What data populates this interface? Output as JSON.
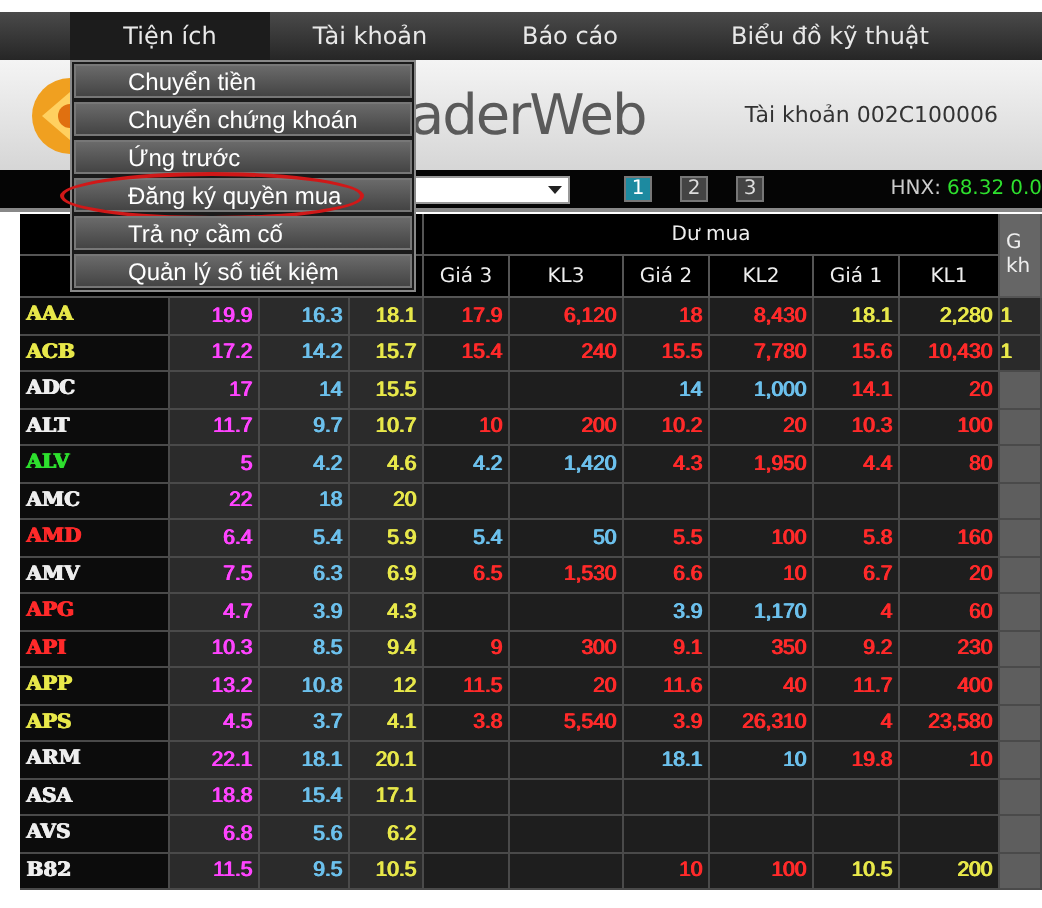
{
  "menu_bar": [
    {
      "label": "Tiện ích",
      "selected": true
    },
    {
      "label": "Tài khoản",
      "selected": false
    },
    {
      "label": "Báo cáo",
      "selected": false
    },
    {
      "label": "Biểu đồ kỹ thuật",
      "selected": false
    }
  ],
  "dropdown_menu": [
    {
      "label": "Chuyển tiền",
      "circled": false
    },
    {
      "label": "Chuyển chứng khoán",
      "circled": false
    },
    {
      "label": "Ứng trước",
      "circled": false
    },
    {
      "label": "Đăng ký quyền mua",
      "circled": true
    },
    {
      "label": "Trả nợ cầm cố",
      "circled": false
    },
    {
      "label": "Quản lý số tiết kiệm",
      "circled": false
    }
  ],
  "header": {
    "app_name": "aderWeb",
    "account": "Tài khoản 002C100006"
  },
  "toolbar": {
    "pages": [
      {
        "label": "1",
        "selected": true
      },
      {
        "label": "2",
        "selected": false
      },
      {
        "label": "3",
        "selected": false
      }
    ],
    "index_name": "HNX:",
    "index_value": "68.32",
    "index_change": "0.0"
  },
  "table": {
    "group_header": "Dư mua",
    "columns": [
      "Giá 3",
      "KL3",
      "Giá 2",
      "KL2",
      "Giá 1",
      "KL1"
    ],
    "column_11": "G kh",
    "rows": [
      {
        "symbol": "AAA",
        "kind": "ref",
        "ceiling": "19.9",
        "floor": "16.3",
        "reference": "18.1",
        "bids": [
          {
            "price": "17.9",
            "volume": "6,120",
            "kind": "down"
          },
          {
            "price": "18",
            "volume": "8,430",
            "kind": "down"
          },
          {
            "price": "18.1",
            "volume": "2,280",
            "kind": "ref"
          }
        ],
        "column_11": {
          "text": "1",
          "kind": "ref"
        }
      },
      {
        "symbol": "ACB",
        "kind": "ref",
        "ceiling": "17.2",
        "floor": "14.2",
        "reference": "15.7",
        "bids": [
          {
            "price": "15.4",
            "volume": "240",
            "kind": "down"
          },
          {
            "price": "15.5",
            "volume": "7,780",
            "kind": "down"
          },
          {
            "price": "15.6",
            "volume": "10,430",
            "kind": "down"
          }
        ],
        "column_11": {
          "text": "1",
          "kind": "ref"
        }
      },
      {
        "symbol": "ADC",
        "kind": "none",
        "ceiling": "17",
        "floor": "14",
        "reference": "15.5",
        "bids": [
          {
            "price": "14",
            "volume": "1,000",
            "kind": "floor"
          },
          {
            "price": "14.1",
            "volume": "20",
            "kind": "down"
          }
        ]
      },
      {
        "symbol": "ALT",
        "kind": "none",
        "ceiling": "11.7",
        "floor": "9.7",
        "reference": "10.7",
        "bids": [
          {
            "price": "10",
            "volume": "200",
            "kind": "down"
          },
          {
            "price": "10.2",
            "volume": "20",
            "kind": "down"
          },
          {
            "price": "10.3",
            "volume": "100",
            "kind": "down"
          }
        ]
      },
      {
        "symbol": "ALV",
        "kind": "up",
        "ceiling": "5",
        "floor": "4.2",
        "reference": "4.6",
        "bids": [
          {
            "price": "4.2",
            "volume": "1,420",
            "kind": "floor"
          },
          {
            "price": "4.3",
            "volume": "1,950",
            "kind": "down"
          },
          {
            "price": "4.4",
            "volume": "80",
            "kind": "down"
          }
        ]
      },
      {
        "symbol": "AMC",
        "kind": "none",
        "ceiling": "22",
        "floor": "18",
        "reference": "20",
        "bids": []
      },
      {
        "symbol": "AMD",
        "kind": "down",
        "ceiling": "6.4",
        "floor": "5.4",
        "reference": "5.9",
        "bids": [
          {
            "price": "5.4",
            "volume": "50",
            "kind": "floor"
          },
          {
            "price": "5.5",
            "volume": "100",
            "kind": "down"
          },
          {
            "price": "5.8",
            "volume": "160",
            "kind": "down"
          }
        ]
      },
      {
        "symbol": "AMV",
        "kind": "none",
        "ceiling": "7.5",
        "floor": "6.3",
        "reference": "6.9",
        "bids": [
          {
            "price": "6.5",
            "volume": "1,530",
            "kind": "down"
          },
          {
            "price": "6.6",
            "volume": "10",
            "kind": "down"
          },
          {
            "price": "6.7",
            "volume": "20",
            "kind": "down"
          }
        ]
      },
      {
        "symbol": "APG",
        "kind": "down",
        "ceiling": "4.7",
        "floor": "3.9",
        "reference": "4.3",
        "bids": [
          {
            "price": "3.9",
            "volume": "1,170",
            "kind": "floor"
          },
          {
            "price": "4",
            "volume": "60",
            "kind": "down"
          }
        ]
      },
      {
        "symbol": "API",
        "kind": "down",
        "ceiling": "10.3",
        "floor": "8.5",
        "reference": "9.4",
        "bids": [
          {
            "price": "9",
            "volume": "300",
            "kind": "down"
          },
          {
            "price": "9.1",
            "volume": "350",
            "kind": "down"
          },
          {
            "price": "9.2",
            "volume": "230",
            "kind": "down"
          }
        ]
      },
      {
        "symbol": "APP",
        "kind": "ref",
        "ceiling": "13.2",
        "floor": "10.8",
        "reference": "12",
        "bids": [
          {
            "price": "11.5",
            "volume": "20",
            "kind": "down"
          },
          {
            "price": "11.6",
            "volume": "40",
            "kind": "down"
          },
          {
            "price": "11.7",
            "volume": "400",
            "kind": "down"
          }
        ]
      },
      {
        "symbol": "APS",
        "kind": "ref",
        "ceiling": "4.5",
        "floor": "3.7",
        "reference": "4.1",
        "bids": [
          {
            "price": "3.8",
            "volume": "5,540",
            "kind": "down"
          },
          {
            "price": "3.9",
            "volume": "26,310",
            "kind": "down"
          },
          {
            "price": "4",
            "volume": "23,580",
            "kind": "down"
          }
        ]
      },
      {
        "symbol": "ARM",
        "kind": "none",
        "ceiling": "22.1",
        "floor": "18.1",
        "reference": "20.1",
        "bids": [
          {
            "price": "18.1",
            "volume": "10",
            "kind": "floor"
          },
          {
            "price": "19.8",
            "volume": "10",
            "kind": "down"
          }
        ]
      },
      {
        "symbol": "ASA",
        "kind": "none",
        "ceiling": "18.8",
        "floor": "15.4",
        "reference": "17.1",
        "bids": []
      },
      {
        "symbol": "AVS",
        "kind": "none",
        "ceiling": "6.8",
        "floor": "5.6",
        "reference": "6.2",
        "bids": []
      },
      {
        "symbol": "B82",
        "kind": "none",
        "ceiling": "11.5",
        "floor": "9.5",
        "reference": "10.5",
        "bids": [
          {
            "price": "10",
            "volume": "100",
            "kind": "down"
          },
          {
            "price": "10.5",
            "volume": "200",
            "kind": "ref"
          }
        ]
      }
    ]
  }
}
